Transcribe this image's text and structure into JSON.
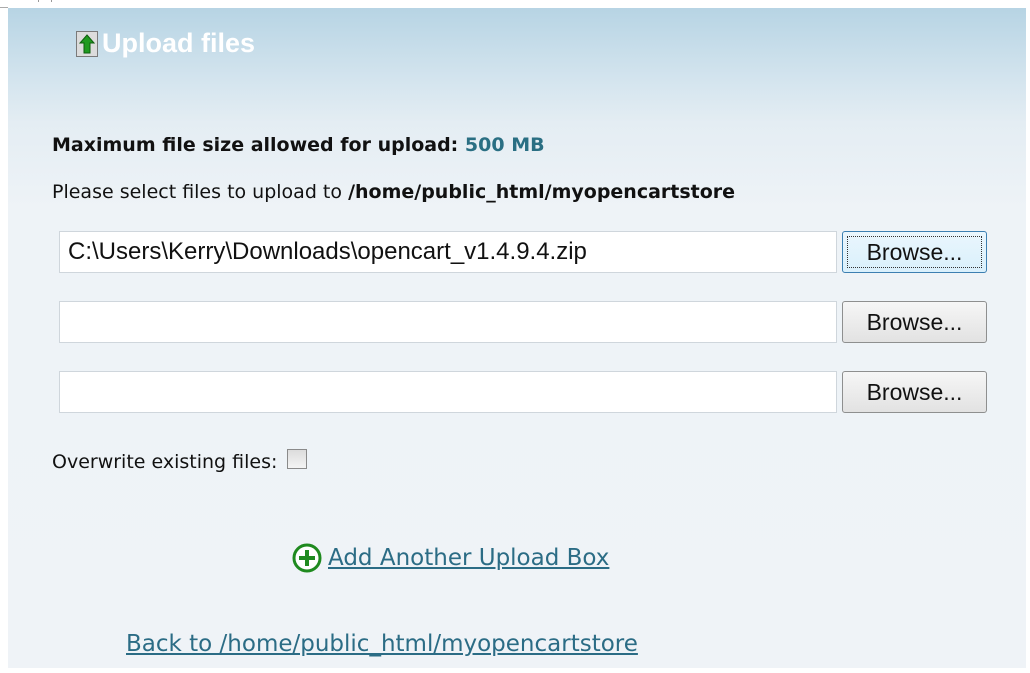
{
  "header": {
    "title": "Upload files",
    "icon": "upload-arrow-icon"
  },
  "info": {
    "max_label": "Maximum file size allowed for upload:",
    "max_value": "500 MB",
    "select_prefix": "Please select files to upload to",
    "select_path": "/home/public_html/myopencartstore"
  },
  "file_inputs": [
    {
      "value": "C:\\Users\\Kerry\\Downloads\\opencart_v1.4.9.4.zip",
      "browse_label": "Browse..."
    },
    {
      "value": "",
      "browse_label": "Browse..."
    },
    {
      "value": "",
      "browse_label": "Browse..."
    }
  ],
  "overwrite": {
    "label": "Overwrite existing files:",
    "checked": false
  },
  "links": {
    "add_box": "Add Another Upload Box",
    "back": "Back to /home/public_html/myopencartstore"
  },
  "colors": {
    "link": "#2b6c85",
    "accent_value": "#2a6f83",
    "header_gradient_top": "#b7d4e4",
    "upload_arrow_green": "#1f9a1f"
  }
}
